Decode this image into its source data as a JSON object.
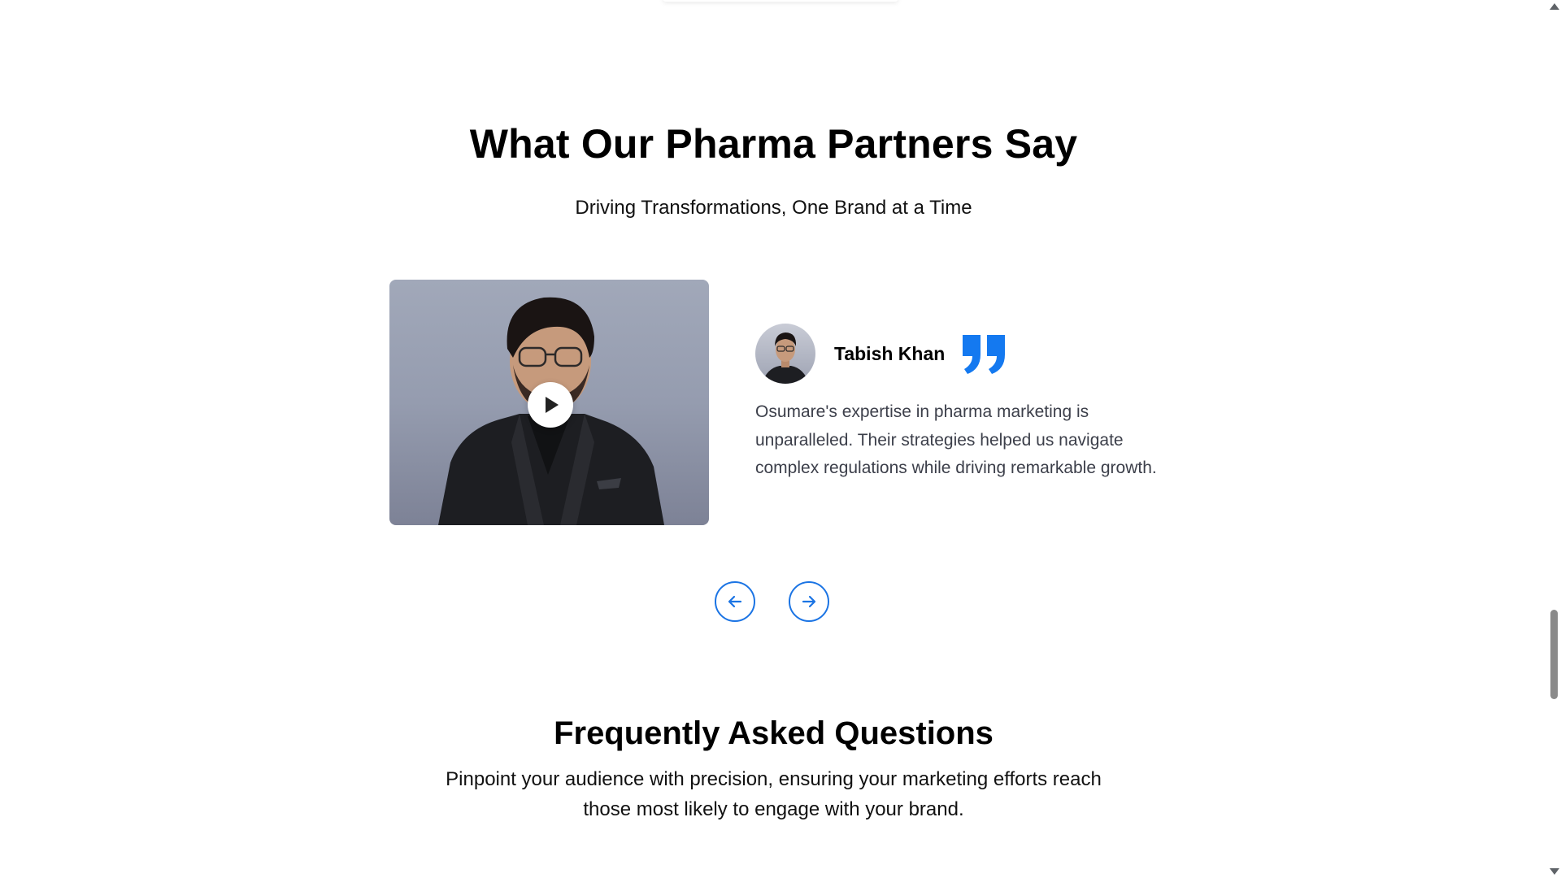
{
  "testimonials": {
    "title": "What Our Pharma Partners Say",
    "subtitle": "Driving Transformations, One Brand at a Time",
    "current": {
      "author_name": "Tabish Khan",
      "quote": "Osumare's expertise in pharma marketing is unparalleled. Their strategies helped us navigate complex regulations while driving remarkable growth."
    }
  },
  "icons": {
    "play": "play-icon",
    "quote": "quote-icon",
    "prev": "arrow-left-icon",
    "next": "arrow-right-icon"
  },
  "colors": {
    "accent": "#1b74e4",
    "quote_icon": "#1479f0",
    "body_text": "#3c3f4a"
  },
  "faq": {
    "title": "Frequently Asked Questions",
    "subtitle": "Pinpoint your audience with precision, ensuring your marketing efforts reach those most likely to engage with your brand."
  }
}
